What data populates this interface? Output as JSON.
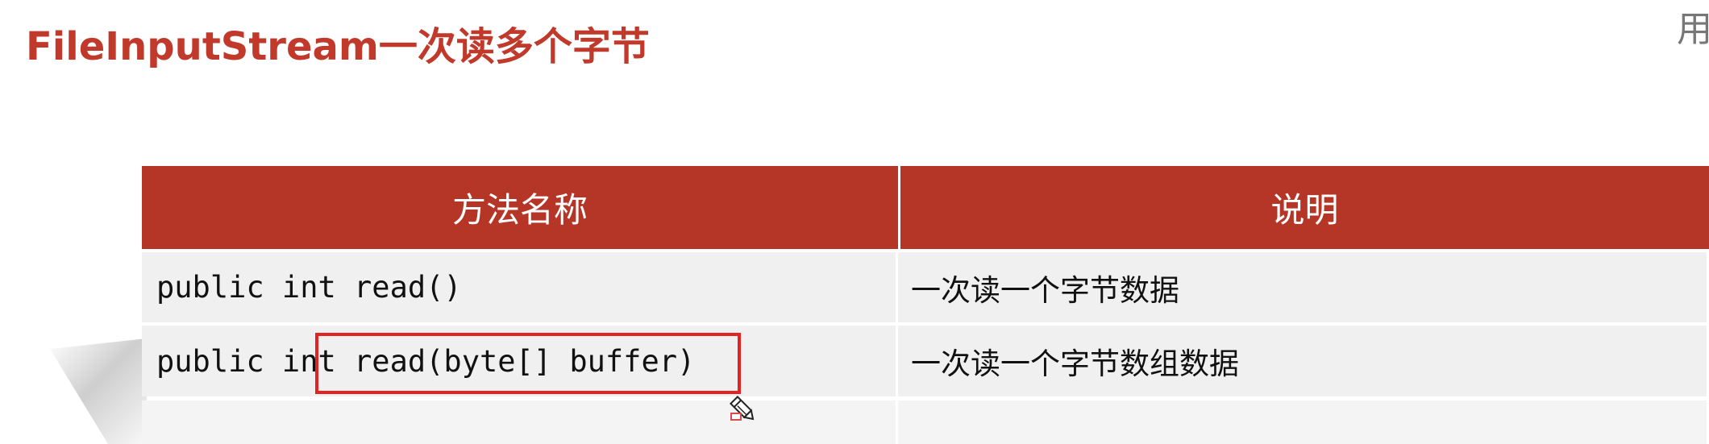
{
  "page": {
    "title": "FileInputStream一次读多个字节",
    "corner_glyph": "用",
    "accent_color": "#b53626",
    "highlight_color": "#e32222"
  },
  "table": {
    "headers": [
      "方法名称",
      "说明"
    ],
    "rows": [
      {
        "method": "public int read()",
        "description": "一次读一个字节数据"
      },
      {
        "method": "public int read(byte[] buffer)",
        "description": "一次读一个字节数组数据"
      },
      {
        "method": "",
        "description": ""
      }
    ]
  },
  "annotation": {
    "cursor_icon": "pen-cursor-icon"
  }
}
